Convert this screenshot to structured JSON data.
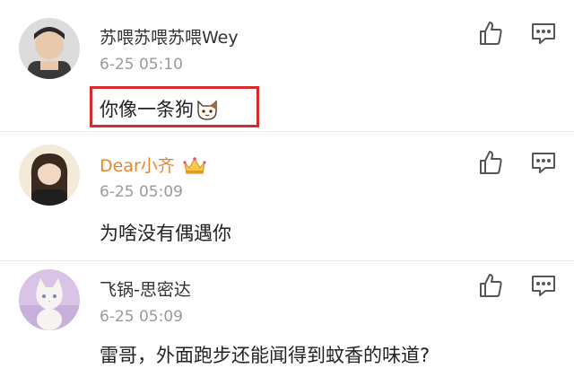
{
  "comments": [
    {
      "username": "苏喂苏喂苏喂Wey",
      "time": "6-25 05:10",
      "text": "你像一条狗",
      "emoji": "cat-face",
      "highlighted": true,
      "highlight_color": "#d62b2b"
    },
    {
      "username": "Dear小齐",
      "username_color": "#e8852b",
      "badge": "crown",
      "time": "6-25 05:09",
      "text": "为啥没有偶遇你"
    },
    {
      "username": "飞锅-思密达",
      "time": "6-25 05:09",
      "text": "雷哥，外面跑步还能闻得到蚊香的味道?"
    }
  ],
  "icons": {
    "like": "thumbs-up-icon",
    "reply": "comment-icon"
  }
}
